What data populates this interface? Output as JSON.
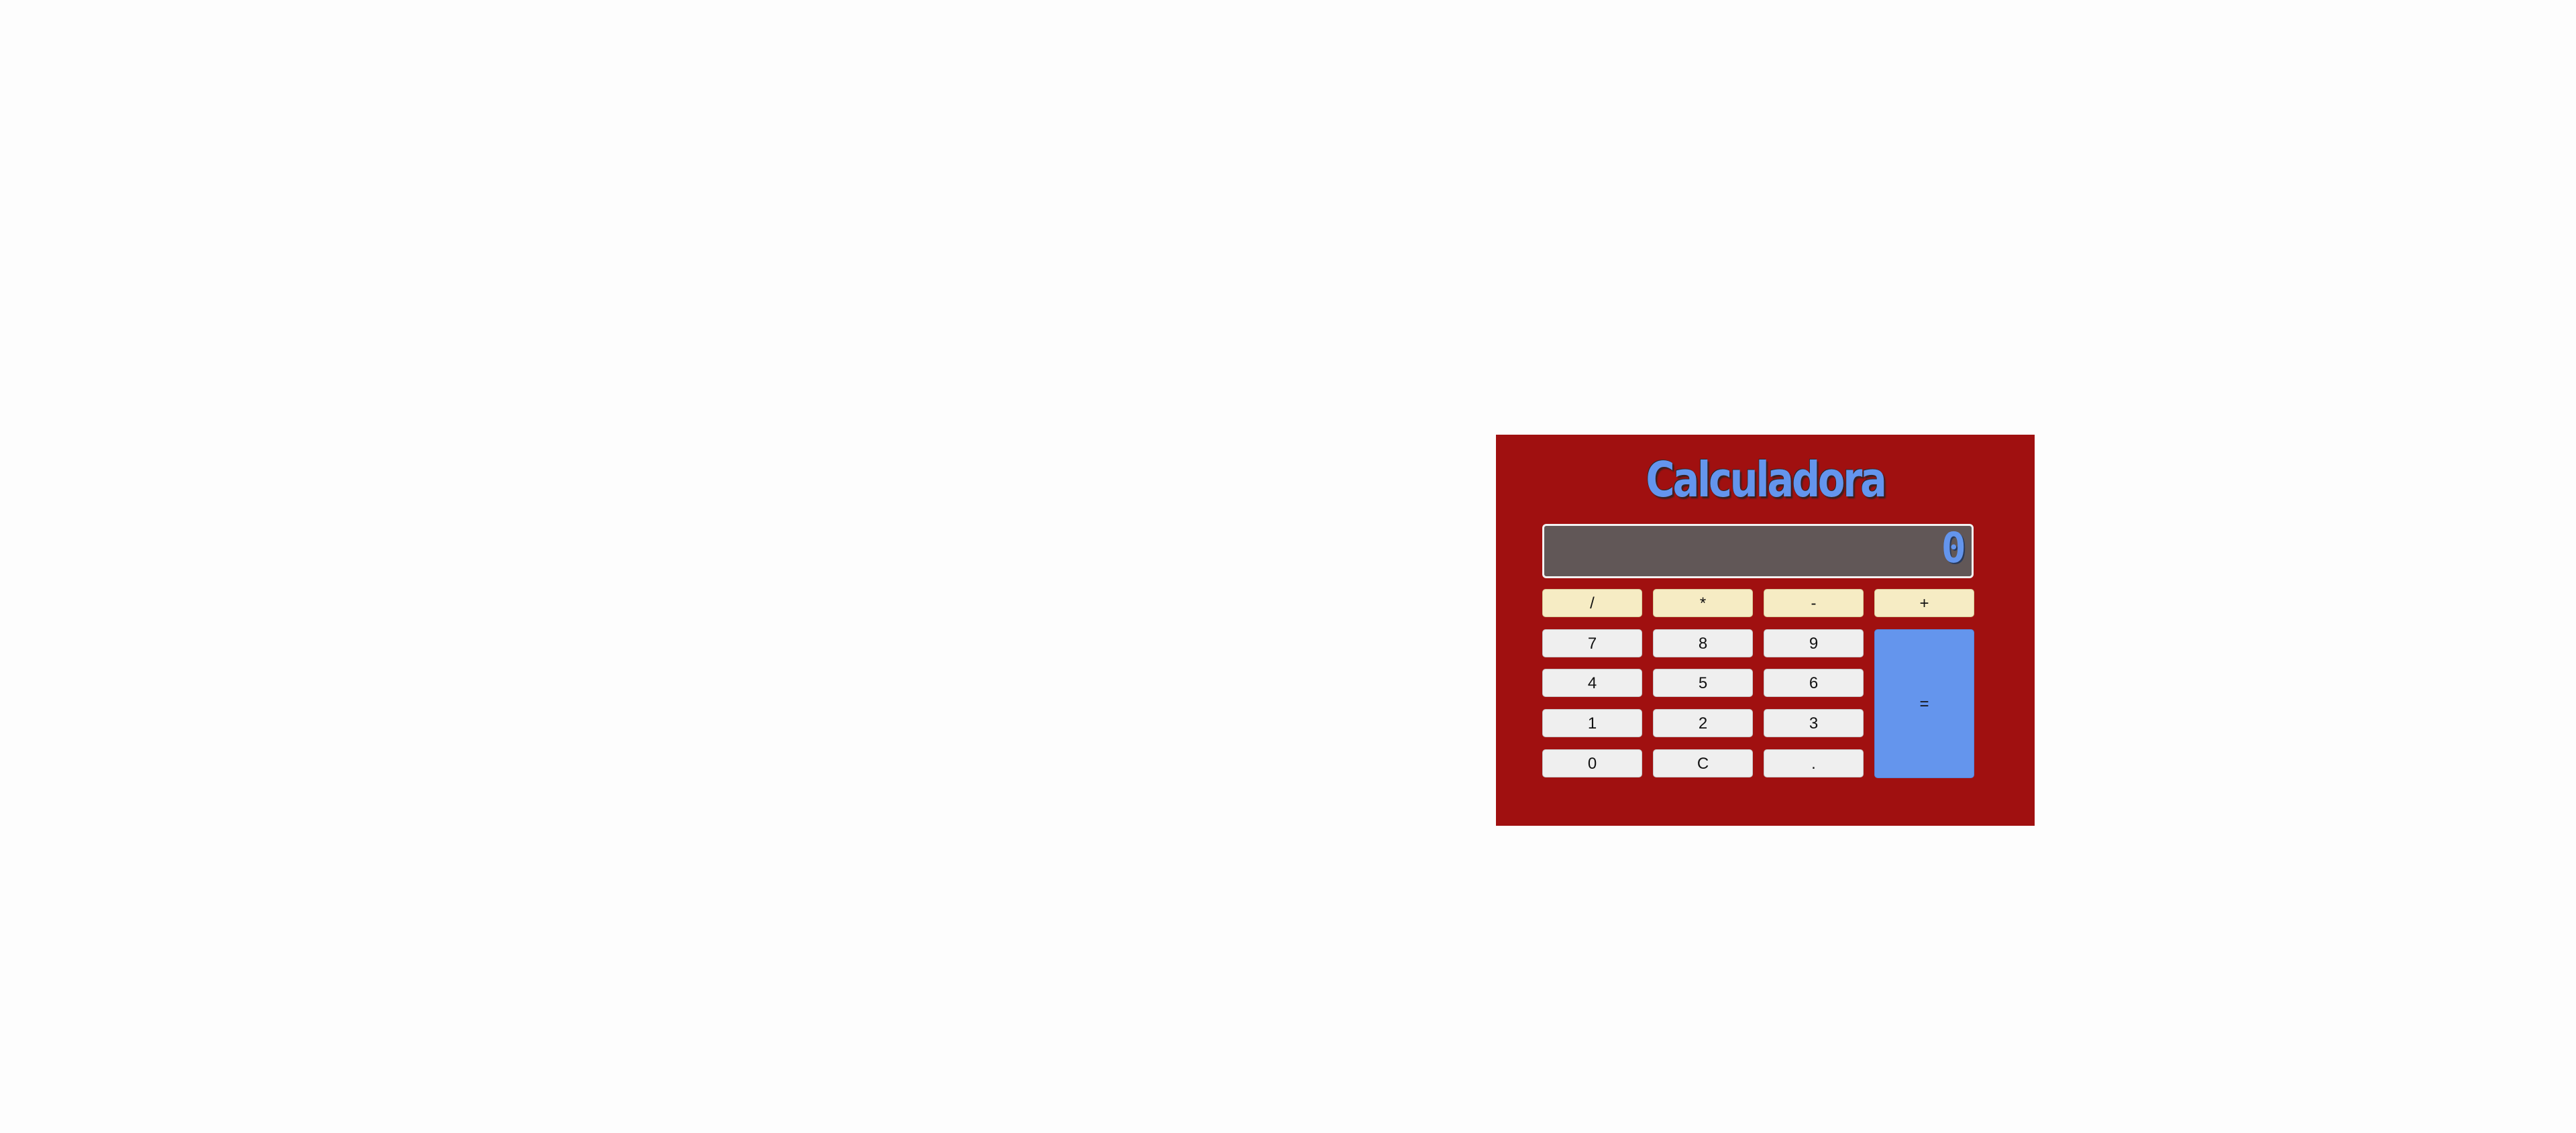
{
  "calculator": {
    "title": "Calculadora",
    "display_value": "0",
    "operators": [
      "/",
      "*",
      "-",
      "+"
    ],
    "rows": [
      [
        "7",
        "8",
        "9"
      ],
      [
        "4",
        "5",
        "6"
      ],
      [
        "1",
        "2",
        "3"
      ],
      [
        "0",
        "C",
        "."
      ]
    ],
    "equals_label": "=",
    "colors": {
      "panel": "#a01010",
      "title": "#6495ed",
      "display_bg": "#615757",
      "operator_button": "#f6ecc4",
      "number_button": "#efefef",
      "equals_button": "#6495ed"
    }
  }
}
